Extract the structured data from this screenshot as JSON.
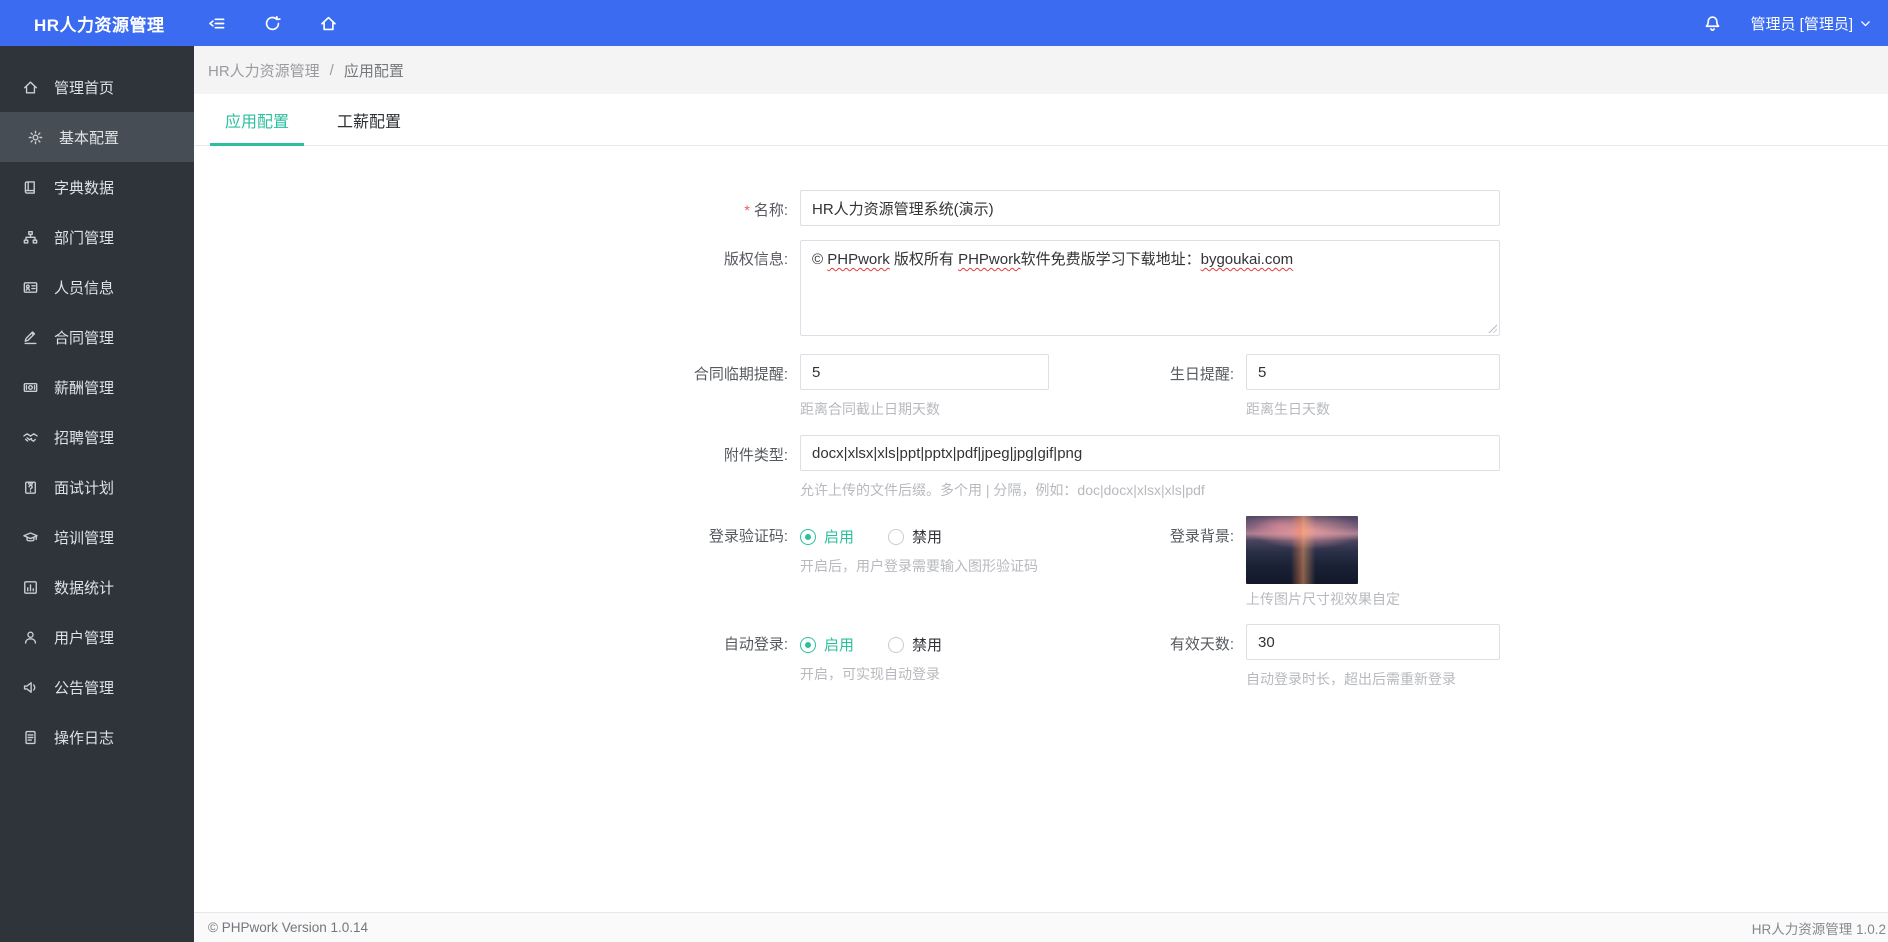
{
  "colors": {
    "topbar": "#3a6bf0",
    "sidebar": "#2f343a",
    "sidebar-active": "#474d54",
    "accent": "#2bbf9e",
    "asterisk": "#f25555"
  },
  "topbar": {
    "brand": "HR人力资源管理",
    "user": "管理员 [管理员]"
  },
  "sidebar": {
    "items": [
      {
        "label": "管理首页"
      },
      {
        "label": "基本配置"
      },
      {
        "label": "字典数据"
      },
      {
        "label": "部门管理"
      },
      {
        "label": "人员信息"
      },
      {
        "label": "合同管理"
      },
      {
        "label": "薪酬管理"
      },
      {
        "label": "招聘管理"
      },
      {
        "label": "面试计划"
      },
      {
        "label": "培训管理"
      },
      {
        "label": "数据统计"
      },
      {
        "label": "用户管理"
      },
      {
        "label": "公告管理"
      },
      {
        "label": "操作日志"
      }
    ]
  },
  "breadcrumb": {
    "root": "HR人力资源管理",
    "separator": "/",
    "current": "应用配置"
  },
  "tabs": [
    {
      "label": "应用配置",
      "active": true
    },
    {
      "label": "工薪配置",
      "active": false
    }
  ],
  "form": {
    "name": {
      "required_mark": "*",
      "label": "名称:",
      "value": "HR人力资源管理系统(演示)"
    },
    "copyright": {
      "label": "版权信息:",
      "parts": [
        "© ",
        "PHPwork",
        " 版权所有 ",
        "PHPwork",
        "软件免费版学习下载地址：",
        "bygoukai.com"
      ]
    },
    "contract_reminder": {
      "label": "合同临期提醒:",
      "value": "5",
      "hint": "距离合同截止日期天数"
    },
    "birthday_reminder": {
      "label": "生日提醒:",
      "value": "5",
      "hint": "距离生日天数"
    },
    "attachment_types": {
      "label": "附件类型:",
      "value": "docx|xlsx|xls|ppt|pptx|pdf|jpeg|jpg|gif|png",
      "hint": "允许上传的文件后缀。多个用 | 分隔，例如：doc|docx|xlsx|xls|pdf"
    },
    "login_captcha": {
      "label": "登录验证码:",
      "option_on": "启用",
      "option_off": "禁用",
      "selected": "启用",
      "hint": "开启后，用户登录需要输入图形验证码"
    },
    "login_background": {
      "label": "登录背景:",
      "hint": "上传图片尺寸视效果自定"
    },
    "auto_login": {
      "label": "自动登录:",
      "option_on": "启用",
      "option_off": "禁用",
      "selected": "启用",
      "hint": "开启，可实现自动登录"
    },
    "valid_days": {
      "label": "有效天数:",
      "value": "30",
      "hint": "自动登录时长，超出后需重新登录"
    }
  },
  "footer": {
    "left": "© PHPwork Version 1.0.14",
    "right": "HR人力资源管理 1.0.2"
  }
}
